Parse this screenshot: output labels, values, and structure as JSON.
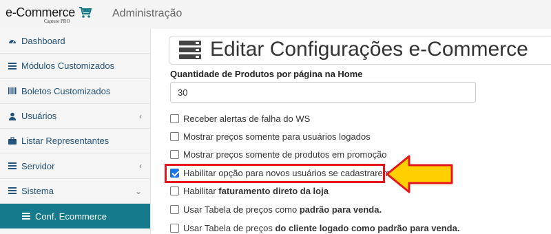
{
  "app": {
    "logo_text": "e-Commerce",
    "logo_subtext": "Capture PRO",
    "header_title": "Administração"
  },
  "sidebar": {
    "items": [
      {
        "label": "Dashboard",
        "icon": "dashboard-icon",
        "chevron": ""
      },
      {
        "label": "Módulos Customizados",
        "icon": "list-icon",
        "chevron": ""
      },
      {
        "label": "Boletos Customizados",
        "icon": "barcode-icon",
        "chevron": ""
      },
      {
        "label": "Usuários",
        "icon": "user-icon",
        "chevron": "‹"
      },
      {
        "label": "Listar Representantes",
        "icon": "briefcase-icon",
        "chevron": ""
      },
      {
        "label": "Servidor",
        "icon": "server-icon",
        "chevron": "‹"
      },
      {
        "label": "Sistema",
        "icon": "server-icon",
        "chevron": "⌄"
      },
      {
        "label": "Conf. Ecommerce",
        "icon": "server-icon",
        "chevron": ""
      }
    ]
  },
  "main": {
    "title": "Editar Configurações e-Commerce",
    "products_label": "Quantidade de Produtos por página na Home",
    "products_value": "30",
    "options": [
      {
        "text": "Receber alertas de falha do WS",
        "checked": false
      },
      {
        "text": "Mostrar preços somente para usuários logados",
        "checked": false
      },
      {
        "text": "Mostrar preços somente de produtos em promoção",
        "checked": false
      },
      {
        "text": "Habilitar opção para novos usuários se cadastrarem",
        "checked": true
      },
      {
        "text_plain": "Habilitar ",
        "text_bold": "faturamento direto da loja",
        "checked": false
      },
      {
        "text_plain": "Usar Tabela de preços como ",
        "text_bold": "padrão para venda.",
        "checked": false
      },
      {
        "text_plain": "Usar Tabela de preços ",
        "text_bold": "do cliente logado como padrão para venda.",
        "checked": false
      }
    ]
  },
  "colors": {
    "accent": "#157a8c",
    "link": "#23527c",
    "highlight": "#e3161b",
    "arrow": "#ffd000"
  }
}
